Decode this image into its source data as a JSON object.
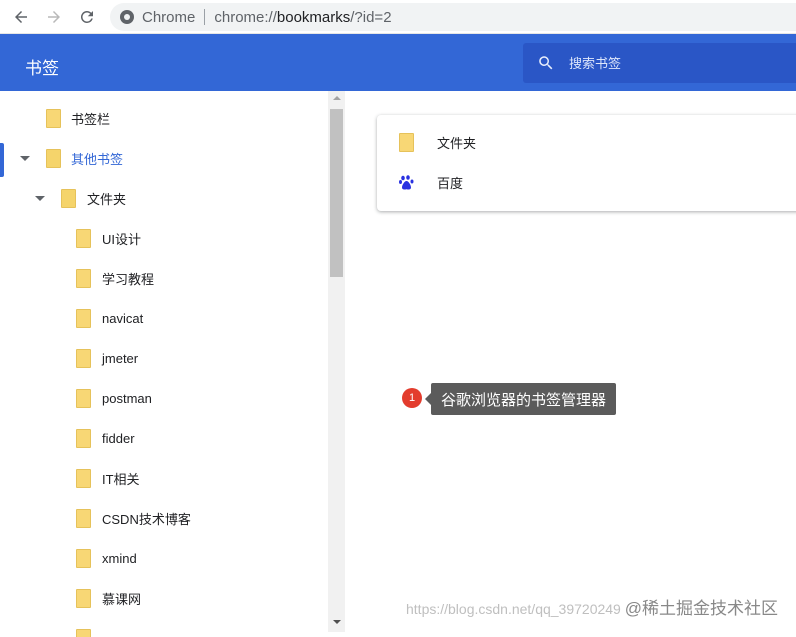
{
  "browser": {
    "omnibox_chip": "Chrome",
    "url_scheme": "chrome://",
    "url_host": "bookmarks",
    "url_path": "/?id=2"
  },
  "header": {
    "title": "书签",
    "search_placeholder": "搜索书签"
  },
  "sidebar": {
    "items": [
      {
        "label": "书签栏"
      },
      {
        "label": "其他书签"
      },
      {
        "label": "文件夹"
      },
      {
        "label": "UI设计"
      },
      {
        "label": "学习教程"
      },
      {
        "label": "navicat"
      },
      {
        "label": "jmeter"
      },
      {
        "label": "postman"
      },
      {
        "label": "fidder"
      },
      {
        "label": "IT相关"
      },
      {
        "label": "CSDN技术博客"
      },
      {
        "label": "xmind"
      },
      {
        "label": "慕课网"
      }
    ]
  },
  "main": {
    "items": [
      {
        "label": "文件夹",
        "icon": "folder-icon"
      },
      {
        "label": "百度",
        "icon": "baidu-paw-icon"
      }
    ]
  },
  "annotation": {
    "badge": "1",
    "text": "谷歌浏览器的书签管理器"
  },
  "watermark": {
    "url": "https://blog.csdn.net/qq_39720249",
    "brand": "@稀土掘金技术社区"
  },
  "colors": {
    "header": "#3367d6",
    "search": "#2a56c6",
    "selected_text": "#3367d6",
    "folder": "#f8d775",
    "badge": "#e33c2d",
    "tooltip": "#5b5b5b"
  }
}
